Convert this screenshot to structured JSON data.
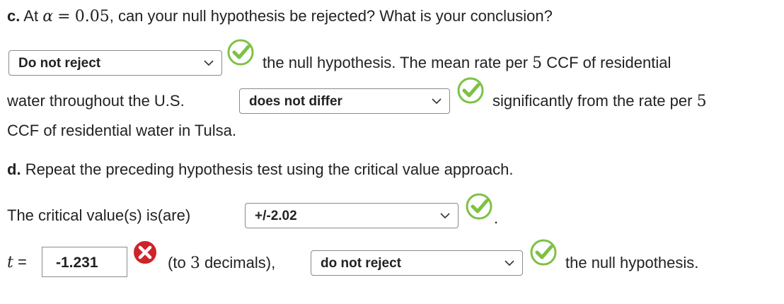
{
  "part_c": {
    "label": "c.",
    "question_before": "At",
    "alpha_symbol": "α",
    "equals": "=",
    "alpha_value": "0.05",
    "question_after": ", can your null hypothesis be rejected? What is your conclusion?",
    "decision_dropdown": "Do not reject",
    "text_after_decision": "the null hypothesis. The mean rate per",
    "num_5_a": "5",
    "text_ccf_residential": "CCF of residential",
    "text_water_us": "water throughout the U.S.",
    "differ_dropdown": "does not differ",
    "text_significantly": "significantly from the rate per",
    "num_5_b": "5",
    "text_tulsa": "CCF of residential water in Tulsa."
  },
  "part_d": {
    "label": "d.",
    "prompt": "Repeat the preceding hypothesis test using the critical value approach.",
    "critical_label": "The critical value(s) is(are)",
    "critical_dropdown": "+/-2.02",
    "critical_period": ".",
    "t_symbol": "t",
    "t_equals": "=",
    "t_value": "-1.231",
    "decimals_text_before": "(to",
    "decimals_num": "3",
    "decimals_text_after": "decimals),",
    "t_decision_dropdown": "do not reject",
    "final_text": "the null hypothesis."
  },
  "icons": {
    "correct": "check-circle-icon",
    "incorrect": "x-circle-icon",
    "dropdown": "chevron-down-icon"
  },
  "colors": {
    "correct_green": "#7DC144",
    "incorrect_red": "#D0222A",
    "text": "#222222"
  }
}
